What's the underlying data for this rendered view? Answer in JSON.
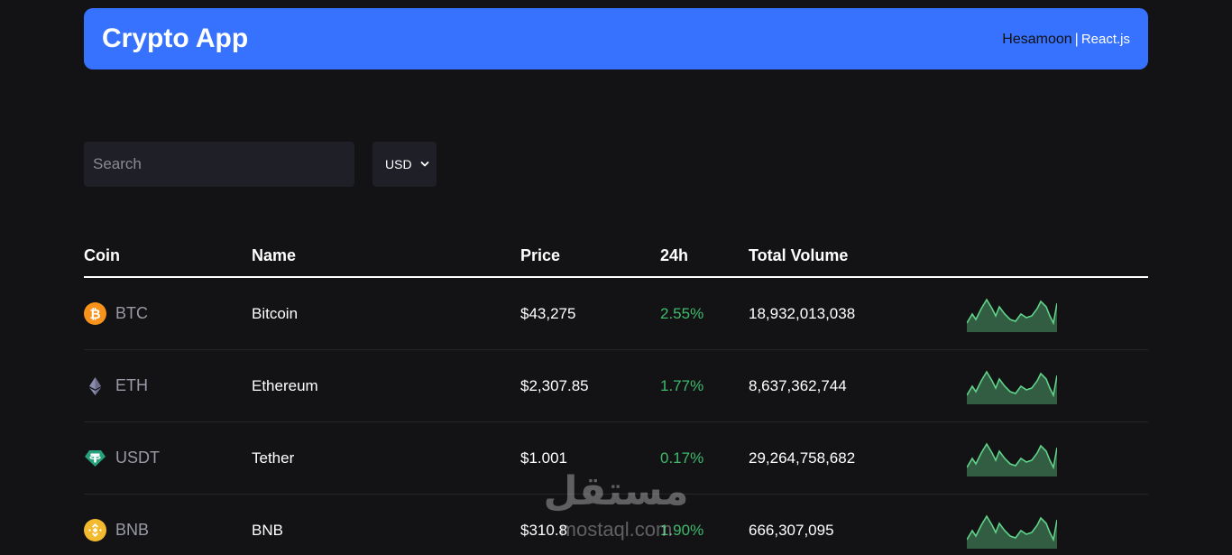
{
  "header": {
    "title": "Crypto App",
    "author": "Hesamoon",
    "separator": "|",
    "tech": "React.js",
    "background": "#3772ff"
  },
  "search": {
    "placeholder": "Search",
    "value": ""
  },
  "currency": {
    "selected": "USD"
  },
  "table": {
    "columns": [
      "Coin",
      "Name",
      "Price",
      "24h",
      "Total Volume"
    ],
    "rows": [
      {
        "symbol": "BTC",
        "name": "Bitcoin",
        "price": "$43,275",
        "change": "2.55%",
        "volume": "18,932,013,038",
        "icon": "bitcoin-icon",
        "icon_color": "#f7931a"
      },
      {
        "symbol": "ETH",
        "name": "Ethereum",
        "price": "$2,307.85",
        "change": "1.77%",
        "volume": "8,637,362,744",
        "icon": "ethereum-icon",
        "icon_color": "#8c8cae"
      },
      {
        "symbol": "USDT",
        "name": "Tether",
        "price": "$1.001",
        "change": "0.17%",
        "volume": "29,264,758,682",
        "icon": "tether-icon",
        "icon_color": "#26a17b"
      },
      {
        "symbol": "BNB",
        "name": "BNB",
        "price": "$310.8",
        "change": "1.90%",
        "volume": "666,307,095",
        "icon": "bnb-icon",
        "icon_color": "#f3ba2f"
      }
    ]
  },
  "colors": {
    "background": "#131316",
    "positive": "#3fba6b",
    "input_bg": "#1f1f28"
  },
  "watermark": {
    "arabic": "مستقل",
    "latin": "mostaql.com"
  }
}
